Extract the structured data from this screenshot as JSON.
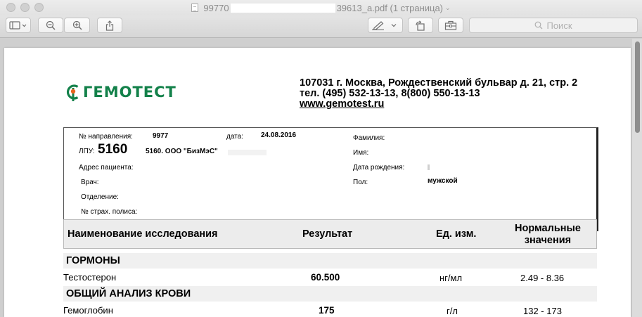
{
  "window": {
    "title_prefix": "99770",
    "title_suffix": "39613_a.pdf (1 страница)",
    "search_placeholder": "Поиск"
  },
  "document": {
    "logo_text": "ГЕМОТЕСТ",
    "address_line1": "107031 г. Москва, Рождественский бульвар д. 21, стр. 2",
    "address_line2": "тел. (495) 532-13-13, 8(800) 550-13-13",
    "website": "www.gemotest.ru",
    "info": {
      "referral_label": "№ направления:",
      "referral_value": "9977",
      "date_label": "дата:",
      "date_value": "24.08.2016",
      "lpu_label": "ЛПУ:",
      "lpu_number": "5160",
      "lpu_name": "5160. ООО \"БизМэС\"",
      "surname_label": "Фамилия:",
      "name_label": "Имя:",
      "patient_address_label": "Адрес пациента:",
      "birth_date_label": "Дата рождения:",
      "doctor_label": "Врач:",
      "sex_label": "Пол:",
      "sex_value": "мужской",
      "department_label": "Отделение:",
      "insurance_label": "№ страх. полиса:"
    },
    "table": {
      "col_name": "Наименование исследования",
      "col_result": "Результат",
      "col_unit": "Ед. изм.",
      "col_norm_line1": "Нормальные",
      "col_norm_line2": "значения",
      "sections": [
        {
          "title": "ГОРМОНЫ",
          "rows": [
            {
              "name": "Тестостерон",
              "result": "60.500",
              "unit": "нг/мл",
              "norm": "2.49 - 8.36"
            }
          ]
        },
        {
          "title": "ОБЩИЙ АНАЛИЗ КРОВИ",
          "rows": [
            {
              "name": "Гемоглобин",
              "result": "175",
              "unit": "г/л",
              "norm": "132 - 173"
            }
          ]
        }
      ]
    }
  },
  "colors": {
    "logo_green": "#13814a",
    "logo_orange": "#e8641e"
  }
}
